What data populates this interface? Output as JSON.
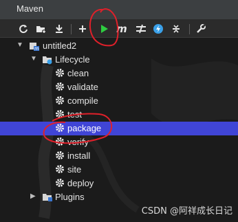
{
  "window": {
    "title": "Maven"
  },
  "toolbar": {
    "buttons": [
      {
        "name": "reload-icon"
      },
      {
        "name": "add-folder-icon"
      },
      {
        "name": "download-icon"
      },
      {
        "name": "add-icon"
      },
      {
        "name": "run-icon"
      },
      {
        "name": "maven-goal-icon",
        "glyph": "m"
      },
      {
        "name": "skip-tests-icon"
      },
      {
        "name": "offline-icon"
      },
      {
        "name": "collapse-icon"
      },
      {
        "name": "settings-wrench-icon"
      }
    ],
    "run_color": "#2ecc40"
  },
  "tree": {
    "project": "untitled2",
    "lifecycle_label": "Lifecycle",
    "goals": [
      "clean",
      "validate",
      "compile",
      "test",
      "package",
      "verify",
      "install",
      "site",
      "deploy"
    ],
    "selected_goal": "package",
    "plugins_label": "Plugins"
  },
  "colors": {
    "selection": "#4045d6",
    "annotation": "#e0202a"
  },
  "watermark": "CSDN @阿祥成长日记"
}
